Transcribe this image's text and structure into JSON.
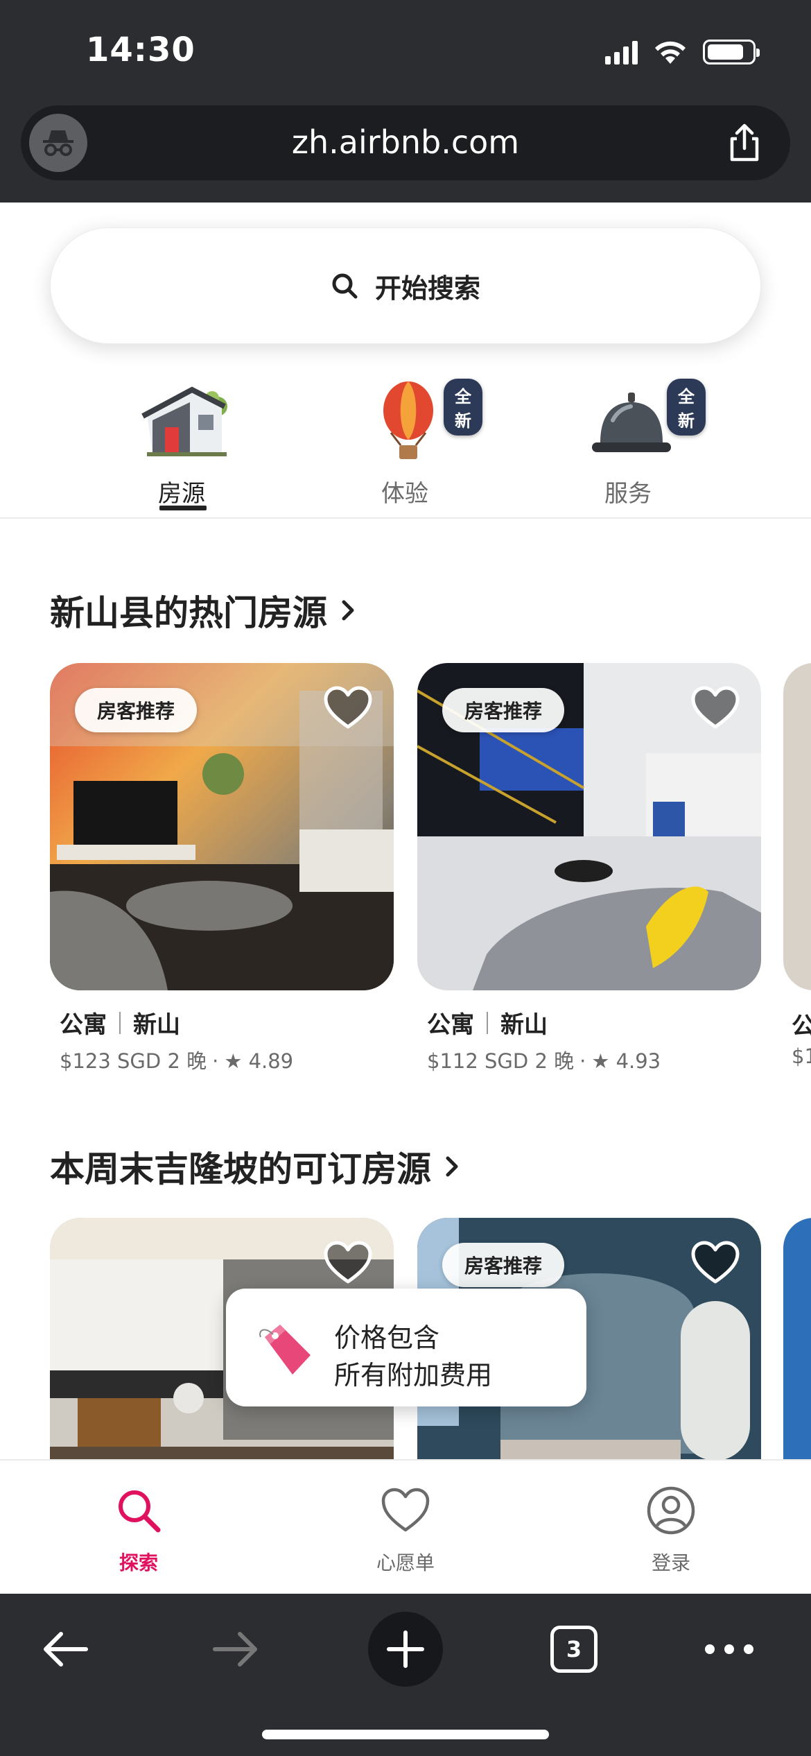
{
  "status_bar": {
    "time": "14:30"
  },
  "browser": {
    "url": "zh.airbnb.com",
    "tab_count": "3"
  },
  "search": {
    "label": "开始搜索"
  },
  "categories": [
    {
      "label": "房源",
      "active": true
    },
    {
      "label": "体验",
      "badge": "全新"
    },
    {
      "label": "服务",
      "badge": "全新"
    }
  ],
  "sections": [
    {
      "title": "新山县的热门房源",
      "cards": [
        {
          "badge": "房客推荐",
          "type": "公寓",
          "location": "新山",
          "price": "$123 SGD 2 晚",
          "rating": "4.89"
        },
        {
          "badge": "房客推荐",
          "type": "公寓",
          "location": "新山",
          "price": "$112 SGD 2 晚",
          "rating": "4.93"
        }
      ],
      "peek": {
        "type": "公",
        "price": "$1"
      }
    },
    {
      "title": "本周末吉隆坡的可订房源",
      "cards": [
        {
          "badge": ""
        },
        {
          "badge": "房客推荐"
        }
      ]
    }
  ],
  "toast": {
    "line1": "价格包含",
    "line2": "所有附加费用"
  },
  "tabbar": [
    {
      "label": "探索",
      "icon": "search-icon",
      "active": true
    },
    {
      "label": "心愿单",
      "icon": "heart-icon"
    },
    {
      "label": "登录",
      "icon": "profile-icon"
    }
  ],
  "colors": {
    "accent": "#e0115f",
    "browser_chrome": "#2b2d31",
    "badge_new": "#2c3a57"
  }
}
